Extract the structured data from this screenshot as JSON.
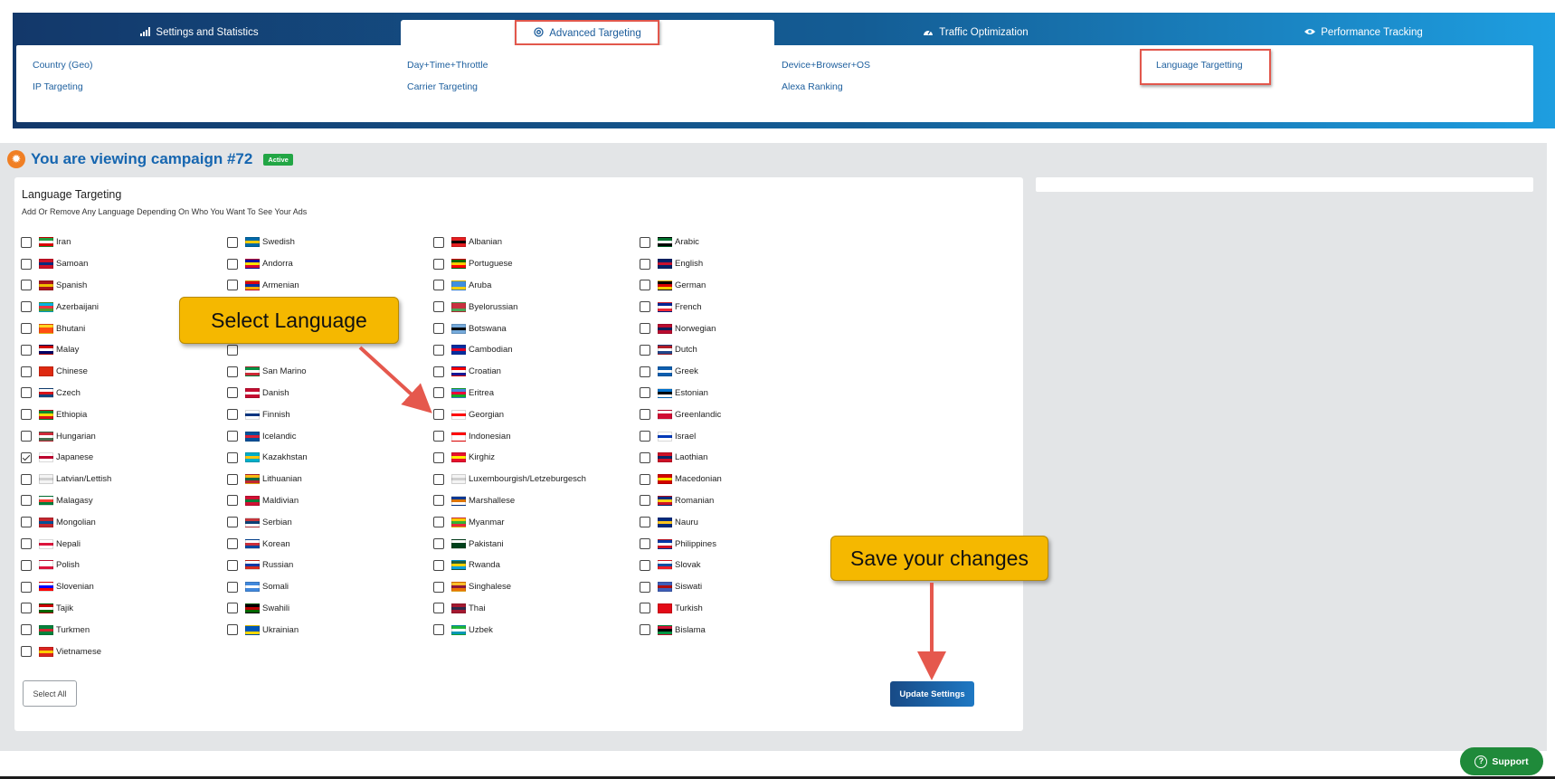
{
  "tabs": [
    {
      "label": "Settings and Statistics",
      "icon": "bar-chart-icon"
    },
    {
      "label": "Advanced Targeting",
      "icon": "target-icon"
    },
    {
      "label": "Traffic Optimization",
      "icon": "gauge-icon"
    },
    {
      "label": "Performance Tracking",
      "icon": "eye-icon"
    }
  ],
  "sublinks": [
    "Country (Geo)",
    "IP Targeting",
    "Day+Time+Throttle",
    "Carrier Targeting",
    "Device+Browser+OS",
    "Alexa Ranking",
    "Language Targetting"
  ],
  "campaign": {
    "title": "You are viewing campaign #72",
    "status": "Active"
  },
  "card": {
    "title": "Language Targeting",
    "subtitle": "Add Or Remove Any Language Depending On Who You Want To See Your Ads"
  },
  "languages": {
    "col1": [
      {
        "name": "Iran",
        "checked": false
      },
      {
        "name": "Samoan",
        "checked": false
      },
      {
        "name": "Spanish",
        "checked": false
      },
      {
        "name": "Azerbaijani",
        "checked": false
      },
      {
        "name": "Bhutani",
        "checked": false
      },
      {
        "name": "Malay",
        "checked": false
      },
      {
        "name": "Chinese",
        "checked": false
      },
      {
        "name": "Czech",
        "checked": false
      },
      {
        "name": "Ethiopia",
        "checked": false
      },
      {
        "name": "Hungarian",
        "checked": false
      },
      {
        "name": "Japanese",
        "checked": true
      },
      {
        "name": "Latvian/Lettish",
        "checked": false
      },
      {
        "name": "Malagasy",
        "checked": false
      },
      {
        "name": "Mongolian",
        "checked": false
      },
      {
        "name": "Nepali",
        "checked": false
      },
      {
        "name": "Polish",
        "checked": false
      },
      {
        "name": "Slovenian",
        "checked": false
      },
      {
        "name": "Tajik",
        "checked": false
      },
      {
        "name": "Turkmen",
        "checked": false
      },
      {
        "name": "Vietnamese",
        "checked": false
      }
    ],
    "col2": [
      {
        "name": "Swedish",
        "checked": false
      },
      {
        "name": "Andorra",
        "checked": false
      },
      {
        "name": "Armenian",
        "checked": false
      },
      {
        "name": "",
        "checked": false
      },
      {
        "name": "",
        "checked": false
      },
      {
        "name": "",
        "checked": false
      },
      {
        "name": "San Marino",
        "checked": false
      },
      {
        "name": "Danish",
        "checked": false
      },
      {
        "name": "Finnish",
        "checked": false
      },
      {
        "name": "Icelandic",
        "checked": false
      },
      {
        "name": "Kazakhstan",
        "checked": false
      },
      {
        "name": "Lithuanian",
        "checked": false
      },
      {
        "name": "Maldivian",
        "checked": false
      },
      {
        "name": "Serbian",
        "checked": false
      },
      {
        "name": "Korean",
        "checked": false
      },
      {
        "name": "Russian",
        "checked": false
      },
      {
        "name": "Somali",
        "checked": false
      },
      {
        "name": "Swahili",
        "checked": false
      },
      {
        "name": "Ukrainian",
        "checked": false
      }
    ],
    "col3": [
      {
        "name": "Albanian",
        "checked": false
      },
      {
        "name": "Portuguese",
        "checked": false
      },
      {
        "name": "Aruba",
        "checked": false
      },
      {
        "name": "Byelorussian",
        "checked": false
      },
      {
        "name": "Botswana",
        "checked": false
      },
      {
        "name": "Cambodian",
        "checked": false
      },
      {
        "name": "Croatian",
        "checked": false
      },
      {
        "name": "Eritrea",
        "checked": false
      },
      {
        "name": "Georgian",
        "checked": false
      },
      {
        "name": "Indonesian",
        "checked": false
      },
      {
        "name": "Kirghiz",
        "checked": false
      },
      {
        "name": "Luxembourgish/Letzeburgesch",
        "checked": false
      },
      {
        "name": "Marshallese",
        "checked": false
      },
      {
        "name": "Myanmar",
        "checked": false
      },
      {
        "name": "Pakistani",
        "checked": false
      },
      {
        "name": "Rwanda",
        "checked": false
      },
      {
        "name": "Singhalese",
        "checked": false
      },
      {
        "name": "Thai",
        "checked": false
      },
      {
        "name": "Uzbek",
        "checked": false
      }
    ],
    "col4": [
      {
        "name": "Arabic",
        "checked": false
      },
      {
        "name": "English",
        "checked": false
      },
      {
        "name": "German",
        "checked": false
      },
      {
        "name": "French",
        "checked": false
      },
      {
        "name": "Norwegian",
        "checked": false
      },
      {
        "name": "Dutch",
        "checked": false
      },
      {
        "name": "Greek",
        "checked": false
      },
      {
        "name": "Estonian",
        "checked": false
      },
      {
        "name": "Greenlandic",
        "checked": false
      },
      {
        "name": "Israel",
        "checked": false
      },
      {
        "name": "Laothian",
        "checked": false
      },
      {
        "name": "Macedonian",
        "checked": false
      },
      {
        "name": "Romanian",
        "checked": false
      },
      {
        "name": "Nauru",
        "checked": false
      },
      {
        "name": "Philippines",
        "checked": false
      },
      {
        "name": "Slovak",
        "checked": false
      },
      {
        "name": "Siswati",
        "checked": false
      },
      {
        "name": "Turkish",
        "checked": false
      },
      {
        "name": "Bislama",
        "checked": false
      }
    ]
  },
  "flag_colors": {
    "Iran": [
      "#239f40",
      "#ffffff",
      "#da0000"
    ],
    "Samoan": [
      "#ce1126",
      "#002b7f",
      "#ce1126"
    ],
    "Spanish": [
      "#aa151b",
      "#f1bf00",
      "#aa151b"
    ],
    "Azerbaijani": [
      "#00b5e2",
      "#ef3340",
      "#509e2f"
    ],
    "Bhutani": [
      "#ffd520",
      "#ff4e12",
      "#ff4e12"
    ],
    "Malay": [
      "#cc0001",
      "#ffffff",
      "#010066"
    ],
    "Chinese": [
      "#de2910",
      "#de2910",
      "#de2910"
    ],
    "Czech": [
      "#ffffff",
      "#d7141a",
      "#11457e"
    ],
    "Ethiopia": [
      "#078930",
      "#fcdd09",
      "#da121a"
    ],
    "Hungarian": [
      "#ce2939",
      "#ffffff",
      "#477050"
    ],
    "Japanese": [
      "#ffffff",
      "#bc002d",
      "#ffffff"
    ],
    "Latvian/Lettish": [
      "#f4f4f4",
      "#cfcfcf",
      "#f4f4f4"
    ],
    "Malagasy": [
      "#ffffff",
      "#fc3d32",
      "#007e3a"
    ],
    "Mongolian": [
      "#c4272f",
      "#015197",
      "#c4272f"
    ],
    "Nepali": [
      "#ffffff",
      "#dc143c",
      "#ffffff"
    ],
    "Polish": [
      "#ffffff",
      "#ffffff",
      "#dc143c"
    ],
    "Slovenian": [
      "#ffffff",
      "#0000ff",
      "#ff0000"
    ],
    "Tajik": [
      "#cc0000",
      "#ffffff",
      "#006600"
    ],
    "Turkmen": [
      "#00843d",
      "#d22630",
      "#00843d"
    ],
    "Vietnamese": [
      "#da251d",
      "#ffcd00",
      "#da251d"
    ],
    "Swedish": [
      "#006aa7",
      "#fecc00",
      "#006aa7"
    ],
    "Andorra": [
      "#10069f",
      "#fedf00",
      "#d50032"
    ],
    "Armenian": [
      "#d90012",
      "#0033a0",
      "#f2a800"
    ],
    "San Marino": [
      "#009246",
      "#ffffff",
      "#ce2b37"
    ],
    "Danish": [
      "#c60c30",
      "#ffffff",
      "#c60c30"
    ],
    "Finnish": [
      "#ffffff",
      "#003580",
      "#ffffff"
    ],
    "Icelandic": [
      "#02529c",
      "#dc1e35",
      "#02529c"
    ],
    "Kazakhstan": [
      "#00afca",
      "#fec50c",
      "#00afca"
    ],
    "Lithuanian": [
      "#fdb913",
      "#006a44",
      "#c1272d"
    ],
    "Maldivian": [
      "#d21034",
      "#007e3a",
      "#d21034"
    ],
    "Serbian": [
      "#c6363c",
      "#0c4076",
      "#ffffff"
    ],
    "Korean": [
      "#ffffff",
      "#cd2e3a",
      "#0047a0"
    ],
    "Russian": [
      "#ffffff",
      "#0039a6",
      "#d52b1e"
    ],
    "Somali": [
      "#4189dd",
      "#ffffff",
      "#4189dd"
    ],
    "Swahili": [
      "#000000",
      "#bb0000",
      "#006600"
    ],
    "Ukrainian": [
      "#0057b7",
      "#0057b7",
      "#ffd700"
    ],
    "Albanian": [
      "#e41e20",
      "#000000",
      "#e41e20"
    ],
    "Portuguese": [
      "#006600",
      "#ffcc00",
      "#ff0000"
    ],
    "Aruba": [
      "#418fde",
      "#418fde",
      "#ffd100"
    ],
    "Byelorussian": [
      "#c8313e",
      "#c8313e",
      "#4aa657"
    ],
    "Botswana": [
      "#75aadb",
      "#000000",
      "#75aadb"
    ],
    "Cambodian": [
      "#032ea1",
      "#e00025",
      "#032ea1"
    ],
    "Croatian": [
      "#ff0000",
      "#ffffff",
      "#171796"
    ],
    "Eritrea": [
      "#4189dd",
      "#ea0437",
      "#12ad2b"
    ],
    "Georgian": [
      "#ffffff",
      "#ff0000",
      "#ffffff"
    ],
    "Indonesian": [
      "#ff0000",
      "#ffffff",
      "#ffffff"
    ],
    "Kirghiz": [
      "#e8112d",
      "#ffef00",
      "#e8112d"
    ],
    "Luxembourgish/Letzeburgesch": [
      "#f4f4f4",
      "#cfcfcf",
      "#f4f4f4"
    ],
    "Marshallese": [
      "#003893",
      "#dd7500",
      "#ffffff"
    ],
    "Myanmar": [
      "#fecb00",
      "#34b233",
      "#ea2839"
    ],
    "Pakistani": [
      "#ffffff",
      "#01411c",
      "#01411c"
    ],
    "Rwanda": [
      "#20603d",
      "#fad201",
      "#00a1de"
    ],
    "Singhalese": [
      "#ffbe29",
      "#8d153a",
      "#eb7400"
    ],
    "Thai": [
      "#a51931",
      "#2d2a4a",
      "#a51931"
    ],
    "Uzbek": [
      "#1eb53a",
      "#ffffff",
      "#0099b5"
    ],
    "Arabic": [
      "#00732f",
      "#ffffff",
      "#000000"
    ],
    "English": [
      "#012169",
      "#c8102e",
      "#012169"
    ],
    "German": [
      "#000000",
      "#dd0000",
      "#ffce00"
    ],
    "French": [
      "#002395",
      "#ffffff",
      "#ed2939"
    ],
    "Norwegian": [
      "#ba0c2f",
      "#00205b",
      "#ba0c2f"
    ],
    "Dutch": [
      "#ae1c28",
      "#ffffff",
      "#21468b"
    ],
    "Greek": [
      "#0d5eaf",
      "#ffffff",
      "#0d5eaf"
    ],
    "Estonian": [
      "#0072ce",
      "#000000",
      "#ffffff"
    ],
    "Greenlandic": [
      "#ffffff",
      "#d00c33",
      "#d00c33"
    ],
    "Israel": [
      "#ffffff",
      "#0038b8",
      "#ffffff"
    ],
    "Laothian": [
      "#ce1126",
      "#002868",
      "#ce1126"
    ],
    "Macedonian": [
      "#d20000",
      "#ffe600",
      "#d20000"
    ],
    "Romanian": [
      "#002b7f",
      "#fcd116",
      "#ce1126"
    ],
    "Nauru": [
      "#002b7f",
      "#ffc61e",
      "#002b7f"
    ],
    "Philippines": [
      "#0038a8",
      "#ffffff",
      "#ce1126"
    ],
    "Slovak": [
      "#ffffff",
      "#0b4ea2",
      "#ee1c25"
    ],
    "Siswati": [
      "#3e5eb9",
      "#b10c0c",
      "#3e5eb9"
    ],
    "Turkish": [
      "#e30a17",
      "#e30a17",
      "#e30a17"
    ],
    "Bislama": [
      "#d21034",
      "#000000",
      "#009543"
    ]
  },
  "buttons": {
    "select_all": "Select All",
    "update": "Update Settings",
    "support": "Support"
  },
  "callouts": {
    "select_language": "Select Language",
    "save_changes": "Save your changes"
  },
  "colors": {
    "accent": "#1666b0",
    "highlight": "#e2574c",
    "callout": "#f5b800",
    "active_badge": "#22a645",
    "support": "#1f8a3a"
  }
}
